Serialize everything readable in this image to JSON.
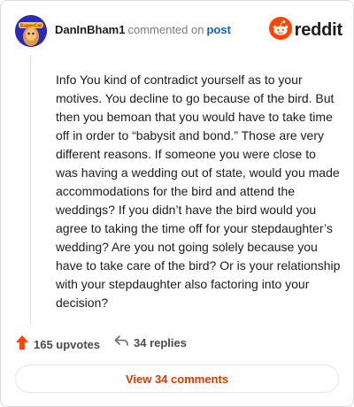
{
  "header": {
    "author": "DanInBham1",
    "action_text": "commented on",
    "post_link": "post",
    "brand": "reddit",
    "avatar_text": "SuperCat",
    "avatar_icon": "user-avatar-icon",
    "brand_icon": "reddit-snoo-icon"
  },
  "comment": {
    "text": "Info You kind of contradict yourself as to your motives. You decline to go because of the bird. But then you bemoan that you would have to take time off in order to “babysit and bond.” Those are very different reasons. If someone you were close to was having a wedding out of state, would you made accommodations for the bird and attend the weddings? If you didn’t have the bird would you agree to taking the time off for your stepdaughter’s wedding? Are you not going solely because you have to take care of the bird? Or is your relationship with your stepdaughter also factoring into your decision?"
  },
  "footer": {
    "upvotes": "165 upvotes",
    "replies": "34 replies",
    "view_button": "View 34 comments"
  },
  "colors": {
    "upvote": "#ff4500",
    "link": "#0a63c8",
    "brand": "#ff4500",
    "button_text": "#d93a00"
  }
}
